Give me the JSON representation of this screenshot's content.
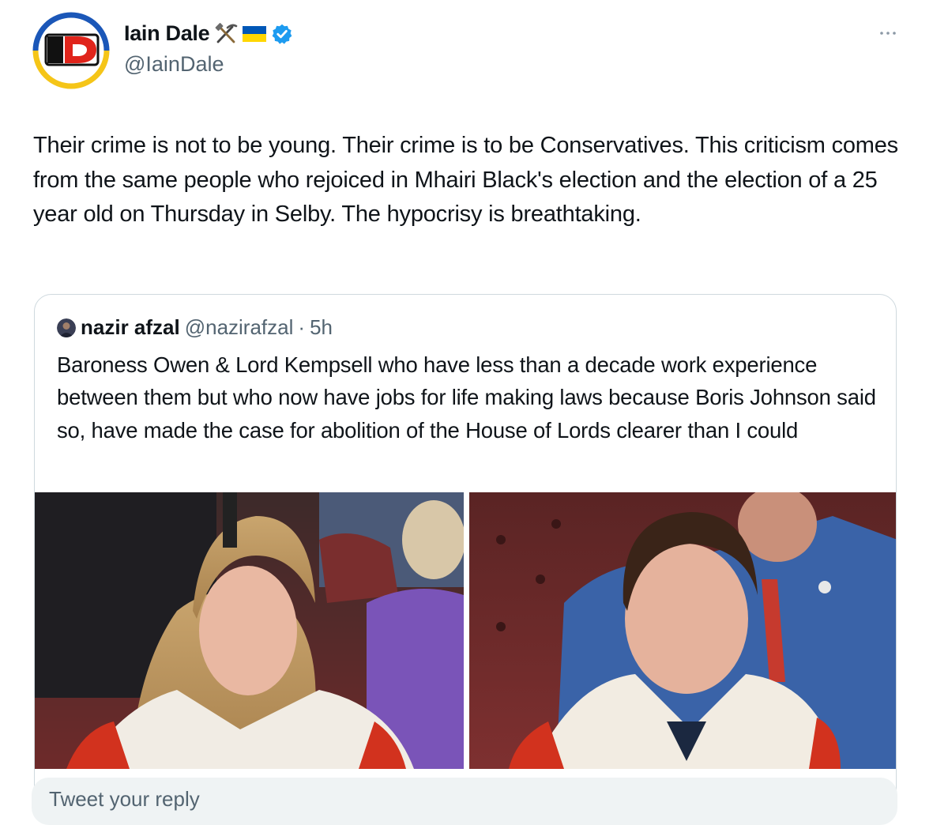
{
  "author": {
    "name": "Iain Dale",
    "handle": "@IainDale",
    "avatar_text": "ID",
    "emoji": [
      "hammer-and-pick",
      "ukraine-flag"
    ],
    "verified": true
  },
  "tweet": {
    "text": "Their crime is not to be young. Their crime is to be Conservatives. This criticism comes from the same people who rejoiced in Mhairi Black's election and the election of a 25 year old on Thursday in Selby. The hypocrisy is breathtaking."
  },
  "quoted": {
    "name": "nazir afzal",
    "handle": "@nazirafzal",
    "separator": "·",
    "time": "5h",
    "text": "Baroness Owen & Lord Kempsell who have less than a decade work experience between them but who now have jobs for life making laws because Boris Johnson said so, have made the case for abolition of the House of Lords clearer than I could"
  },
  "reply": {
    "placeholder": "Tweet your reply"
  },
  "colors": {
    "verified_blue": "#1d9bf0",
    "logo_red": "#e0241b",
    "ukraine_blue": "#0057b7",
    "ukraine_yellow": "#ffd700"
  }
}
